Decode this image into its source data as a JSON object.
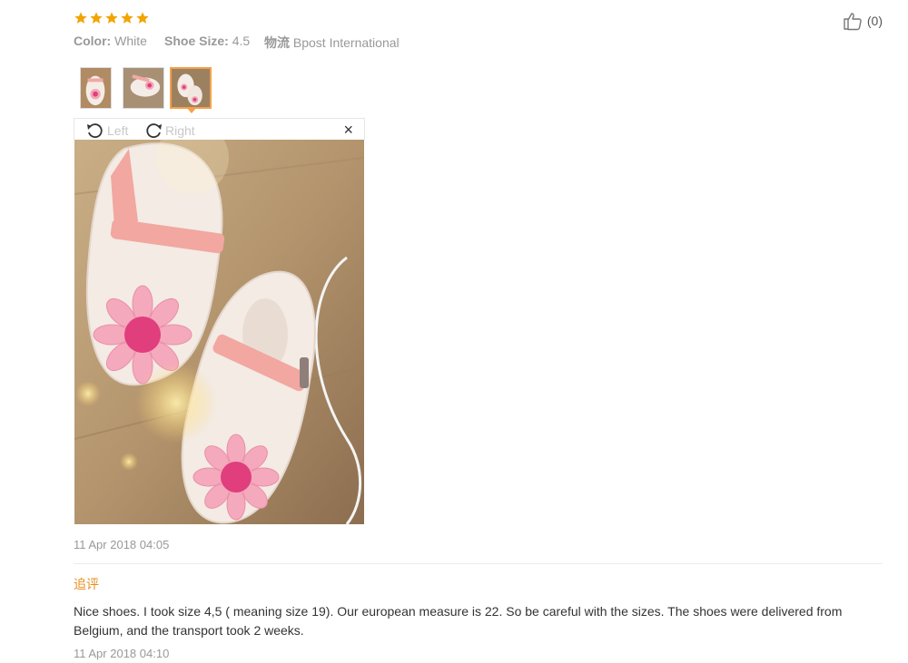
{
  "review": {
    "rating": 5,
    "color_label": "Color:",
    "color_value": "White",
    "size_label": "Shoe Size:",
    "size_value": "4.5",
    "shipping_label": "物流",
    "shipping_value": "Bpost International",
    "helpful_count": "(0)",
    "date": "11 Apr 2018 04:05"
  },
  "viewer": {
    "rotate_left": "Left",
    "rotate_right": "Right",
    "close": "×"
  },
  "followup": {
    "label": "追评",
    "text": "Nice shoes. I took size 4,5 ( meaning size 19). Our european measure is 22. So be careful with the sizes. The shoes were delivered from Belgium, and the transport took 2 weeks.",
    "date": "11 Apr 2018 04:10"
  },
  "colors": {
    "star": "#f2a400",
    "accent": "#f5a04a",
    "followup_label": "#e98d1c"
  }
}
